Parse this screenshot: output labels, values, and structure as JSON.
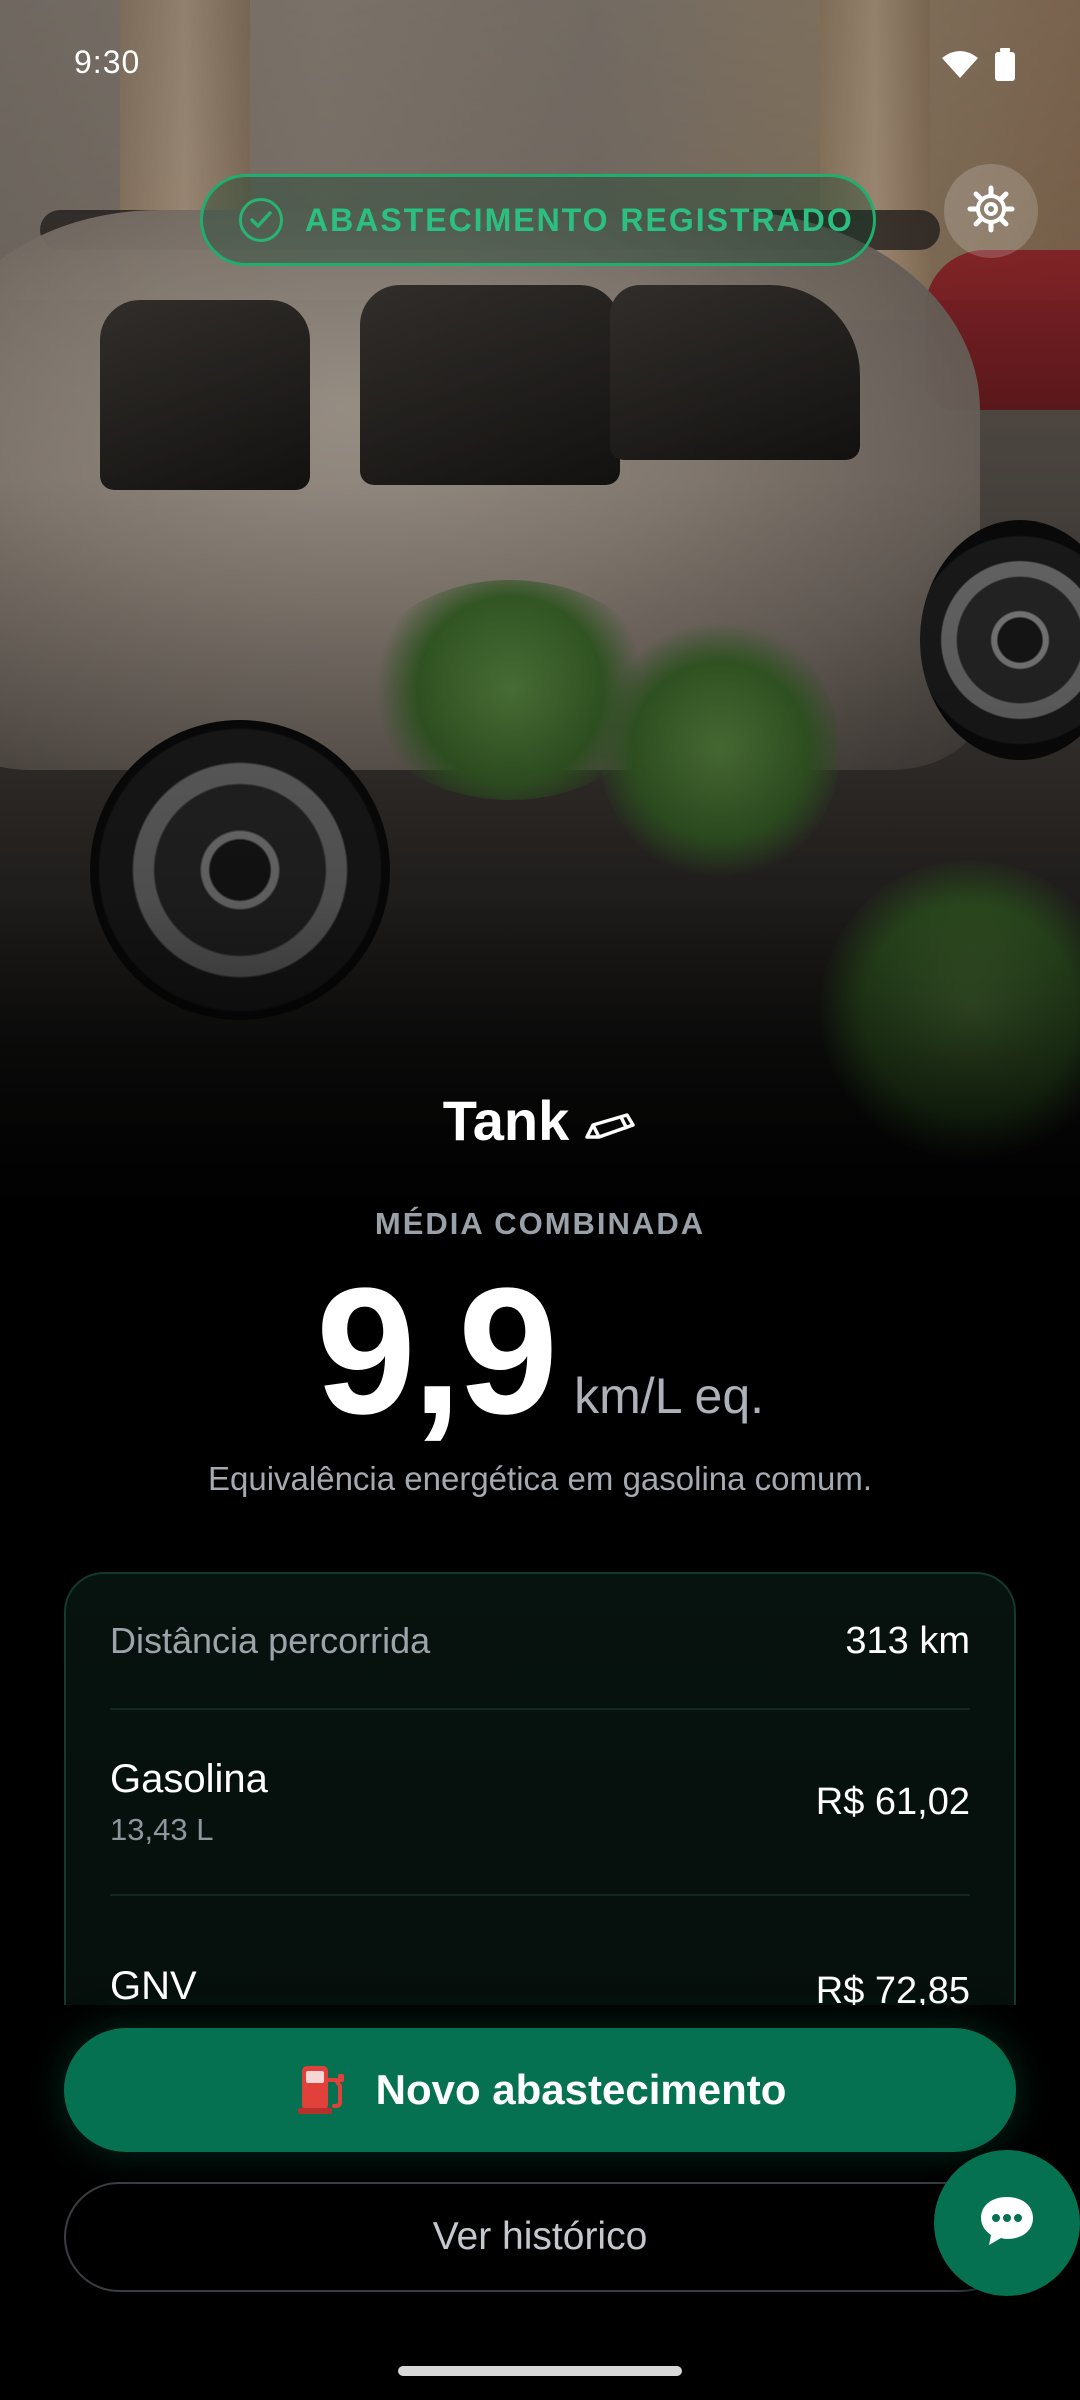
{
  "status_bar": {
    "time": "9:30"
  },
  "banner": {
    "text": "ABASTECIMENTO REGISTRADO",
    "accent_color": "#2bc081"
  },
  "vehicle": {
    "name": "Tank",
    "edit_icon": "pencil-icon"
  },
  "average": {
    "label": "MÉDIA COMBINADA",
    "value": "9,9",
    "unit": "km/L eq.",
    "note": "Equivalência energética em gasolina comum."
  },
  "summary": {
    "distance_label": "Distância percorrida",
    "distance_value": "313 km",
    "fuels": [
      {
        "name": "Gasolina",
        "detail": "13,43 L",
        "cost": "R$ 61,02"
      },
      {
        "name": "GNV",
        "detail": "",
        "cost": "R$ 72,85"
      }
    ]
  },
  "actions": {
    "primary_label": "Novo abastecimento",
    "primary_icon": "fuel-pump-icon",
    "primary_color": "#057150",
    "secondary_label": "Ver histórico"
  },
  "icons": {
    "settings": "gear-icon",
    "chat": "chat-bubble-icon",
    "wifi": "wifi-icon",
    "battery": "battery-icon"
  }
}
